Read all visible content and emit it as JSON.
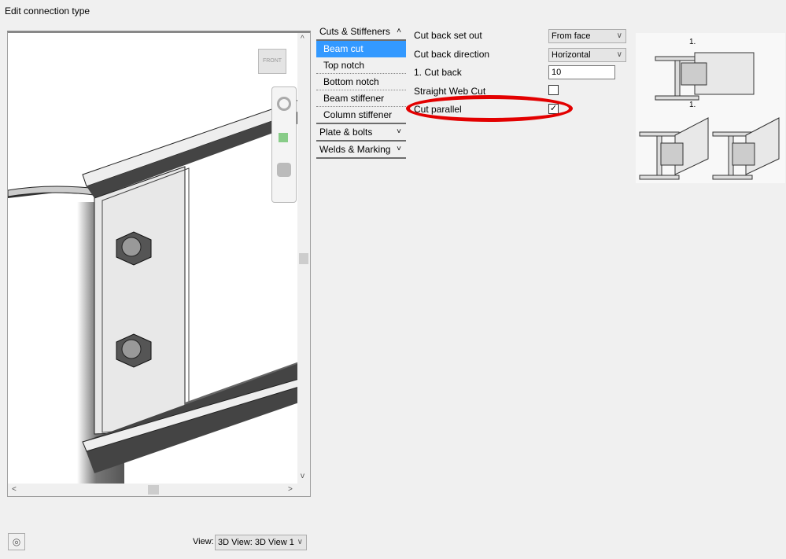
{
  "window": {
    "title": "Edit connection type"
  },
  "viewport": {
    "cube_label": "FRONT"
  },
  "nav": {
    "sections": [
      {
        "label": "Cuts & Stiffeners",
        "expanded": true,
        "items": [
          {
            "label": "Beam cut",
            "selected": true
          },
          {
            "label": "Top notch"
          },
          {
            "label": "Bottom notch"
          },
          {
            "label": "Beam stiffener"
          },
          {
            "label": "Column stiffener"
          }
        ]
      },
      {
        "label": "Plate & bolts",
        "expanded": false
      },
      {
        "label": "Welds & Marking",
        "expanded": false
      }
    ]
  },
  "props": {
    "cut_back_set_out": {
      "label": "Cut back set out",
      "value": "From face"
    },
    "cut_back_direction": {
      "label": "Cut back direction",
      "value": "Horizontal"
    },
    "cut_back": {
      "label": "1. Cut back",
      "value": "10"
    },
    "straight_web_cut": {
      "label": "Straight Web Cut",
      "checked": false
    },
    "cut_parallel": {
      "label": "Cut parallel",
      "checked": true
    }
  },
  "sketch": {
    "dim_label": "1."
  },
  "footer": {
    "view_label": "View:",
    "view_value": "3D View: 3D View 1"
  },
  "colors": {
    "selection": "#3399ff",
    "highlight": "#e30000"
  }
}
